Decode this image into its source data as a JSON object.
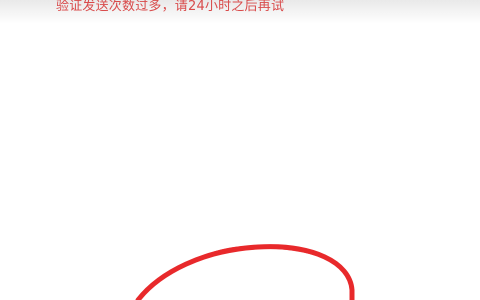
{
  "message": {
    "text": "验证发送次数过多，请24小时之后再试",
    "color": "#d94b4b"
  },
  "annotation": {
    "shape": "hand-drawn-circle",
    "color": "#e8292b"
  }
}
